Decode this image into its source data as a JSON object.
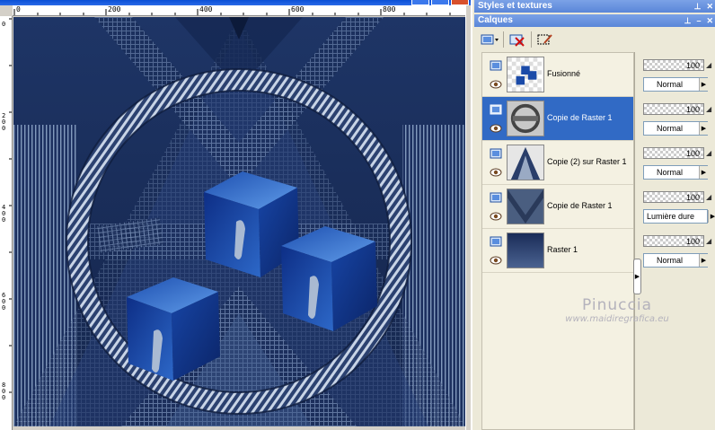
{
  "palettes": {
    "styles_title": "Styles et textures",
    "layers_title": "Calques"
  },
  "rulers": {
    "top": [
      "0",
      "200",
      "400",
      "600",
      "800"
    ],
    "left": [
      "0",
      "2 0 0",
      "4 0 0",
      "6 0 0",
      "8 0 0"
    ]
  },
  "layers": [
    {
      "name": "Fusionné",
      "opacity": "100",
      "blend": "Normal",
      "selected": false
    },
    {
      "name": "Copie de Raster 1",
      "opacity": "100",
      "blend": "Normal",
      "selected": true
    },
    {
      "name": "Copie (2) sur Raster 1",
      "opacity": "100",
      "blend": "Normal",
      "selected": false
    },
    {
      "name": "Copie de Raster 1",
      "opacity": "100",
      "blend": "Lumière dure",
      "selected": false
    },
    {
      "name": "Raster 1",
      "opacity": "100",
      "blend": "Normal",
      "selected": false
    }
  ],
  "icons": {
    "pin": "pin-icon",
    "close": "close-icon",
    "eye": "eye-icon",
    "layer": "layer-icon",
    "new_layer": "new-layer-icon",
    "delete_layer": "delete-layer-icon",
    "edit_selection": "edit-selection-icon"
  },
  "watermark": {
    "name": "Pinuccia",
    "url": "www.maidiregrafica.eu"
  },
  "colors": {
    "selection": "#316ac5",
    "titlebar": "#5a86d8",
    "canvas_base": "#1b2c52"
  }
}
